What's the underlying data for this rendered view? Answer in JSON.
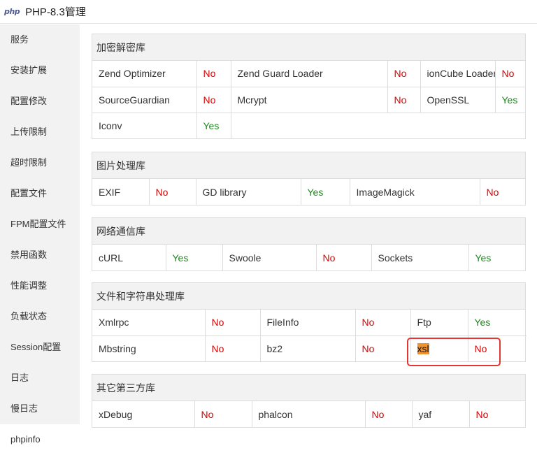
{
  "titlebar": {
    "logo": "php",
    "title": "PHP-8.3管理"
  },
  "sidebar": {
    "items": [
      "服务",
      "安装扩展",
      "配置修改",
      "上传限制",
      "超时限制",
      "配置文件",
      "FPM配置文件",
      "禁用函数",
      "性能调整",
      "负载状态",
      "Session配置",
      "日志",
      "慢日志",
      "phpinfo"
    ],
    "active": "phpinfo"
  },
  "sections": {
    "crypto": {
      "title": "加密解密库",
      "rows": [
        [
          [
            "Zend Optimizer",
            "No"
          ],
          [
            "Zend Guard Loader",
            "No"
          ],
          [
            "ionCube Loader",
            "No"
          ]
        ],
        [
          [
            "SourceGuardian",
            "No"
          ],
          [
            "Mcrypt",
            "No"
          ],
          [
            "OpenSSL",
            "Yes"
          ]
        ],
        [
          [
            "Iconv",
            "Yes"
          ]
        ]
      ]
    },
    "image": {
      "title": "图片处理库",
      "rows": [
        [
          [
            "EXIF",
            "No"
          ],
          [
            "GD library",
            "Yes"
          ],
          [
            "ImageMagick",
            "No"
          ]
        ]
      ]
    },
    "network": {
      "title": "网络通信库",
      "rows": [
        [
          [
            "cURL",
            "Yes"
          ],
          [
            "Swoole",
            "No"
          ],
          [
            "Sockets",
            "Yes"
          ]
        ]
      ]
    },
    "files": {
      "title": "文件和字符串处理库",
      "rows": [
        [
          [
            "Xmlrpc",
            "No"
          ],
          [
            "FileInfo",
            "No"
          ],
          [
            "Ftp",
            "Yes"
          ]
        ],
        [
          [
            "Mbstring",
            "No"
          ],
          [
            "bz2",
            "No"
          ],
          [
            "xsl",
            "No"
          ]
        ]
      ]
    },
    "thirdparty": {
      "title": "其它第三方库",
      "rows": [
        [
          [
            "xDebug",
            "No"
          ],
          [
            "phalcon",
            "No"
          ],
          [
            "yaf",
            "No"
          ]
        ]
      ]
    }
  },
  "colors": {
    "yes": "#1d8a1d",
    "no": "#e00000",
    "highlight": "#f0922e",
    "annotation_box": "#e23535"
  }
}
